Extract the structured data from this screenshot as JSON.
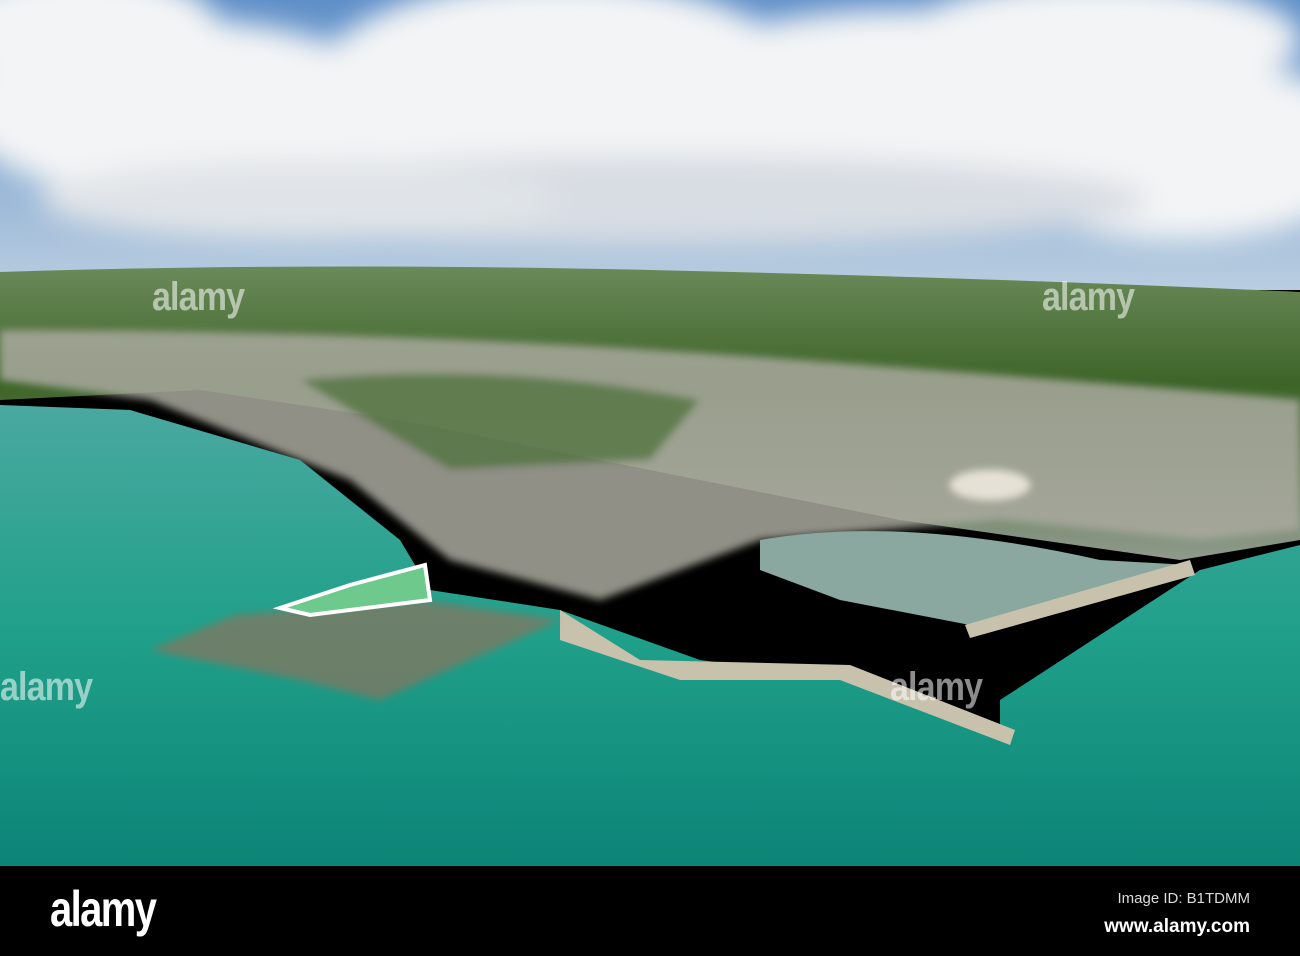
{
  "photo": {
    "subject": "aerial view of coastal harbour town"
  },
  "watermark": {
    "text": "alamy"
  },
  "footer": {
    "logo": "alamy",
    "image_id": "Image ID: B1TDMM",
    "site": "www.alamy.com"
  },
  "colors": {
    "sea": "#1f9e8c",
    "sky": "#6f9fd0",
    "land": "#3f6a2c",
    "footer": "#000000"
  }
}
